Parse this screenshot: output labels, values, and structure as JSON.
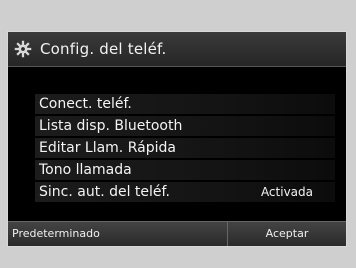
{
  "header": {
    "title": "Config. del teléf.",
    "icon": "gear-icon"
  },
  "menu": {
    "items": [
      {
        "label": "Conect. teléf.",
        "value": ""
      },
      {
        "label": "Lista disp. Bluetooth",
        "value": ""
      },
      {
        "label": "Editar Llam. Rápida",
        "value": ""
      },
      {
        "label": "Tono llamada",
        "value": ""
      },
      {
        "label": "Sinc. aut. del teléf.",
        "value": "Activada"
      }
    ]
  },
  "footer": {
    "left_label": "Predeterminado",
    "right_label": "Aceptar"
  }
}
